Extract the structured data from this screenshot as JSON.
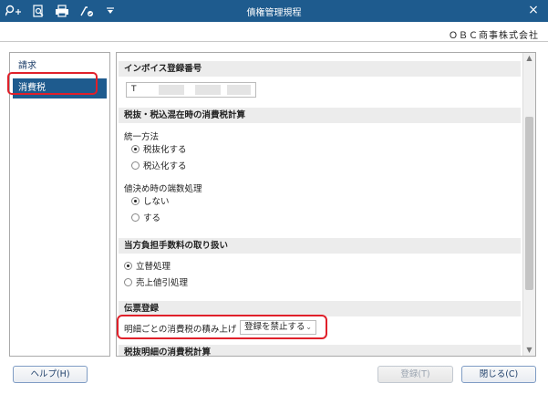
{
  "titlebar": {
    "title": "債権管理規程",
    "close": "×",
    "icons": [
      "search-plus-icon",
      "preview-icon",
      "printer-icon",
      "tool-icon",
      "dropdown-icon"
    ]
  },
  "company": "ＯＢＣ商事株式会社",
  "sidebar": {
    "items": [
      {
        "label": "請求",
        "selected": false
      },
      {
        "label": "消費税",
        "selected": true
      }
    ]
  },
  "content": {
    "invoice": {
      "title": "インボイス登録番号",
      "prefix": "T"
    },
    "tax_calc": {
      "title": "税抜・税込混在時の消費税計算",
      "method_label": "統一方法",
      "options": [
        "税抜化する",
        "税込化する"
      ],
      "selected": 0
    },
    "rounding": {
      "label": "値決め時の端数処理",
      "options": [
        "しない",
        "する"
      ],
      "selected": 0
    },
    "fee": {
      "title": "当方負担手数料の取り扱い",
      "options": [
        "立替処理",
        "売上値引処理"
      ],
      "selected": 0
    },
    "voucher": {
      "title": "伝票登録",
      "field_label": "明細ごとの消費税の積み上げ",
      "select_value": "登録を禁止する"
    },
    "next_section": "税抜明細の消費税計算"
  },
  "buttons": {
    "help": "ヘルプ(H)",
    "register": "登録(T)",
    "close": "閉じる(C)"
  }
}
